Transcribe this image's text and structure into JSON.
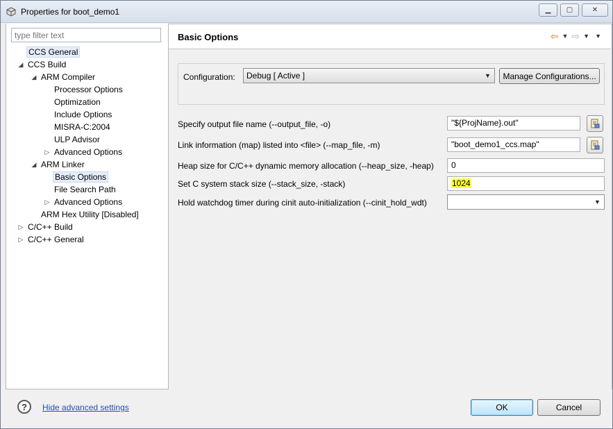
{
  "window": {
    "title": "Properties for boot_demo1",
    "icon": "properties-window-icon",
    "controls": [
      "minimize",
      "maximize",
      "close"
    ]
  },
  "filter": {
    "placeholder": "type filter text",
    "value": ""
  },
  "tree": {
    "items": [
      {
        "label": "CCS General",
        "twisty": "",
        "selected_outline": true
      },
      {
        "label": "CCS Build",
        "twisty": "expanded"
      },
      {
        "label": "ARM Compiler",
        "twisty": "expanded"
      },
      {
        "label": "Processor Options",
        "twisty": ""
      },
      {
        "label": "Optimization",
        "twisty": ""
      },
      {
        "label": "Include Options",
        "twisty": ""
      },
      {
        "label": "MISRA-C:2004",
        "twisty": ""
      },
      {
        "label": "ULP Advisor",
        "twisty": ""
      },
      {
        "label": "Advanced Options",
        "twisty": "collapsed"
      },
      {
        "label": "ARM Linker",
        "twisty": "expanded"
      },
      {
        "label": "Basic Options",
        "twisty": "",
        "selected": true
      },
      {
        "label": "File Search Path",
        "twisty": ""
      },
      {
        "label": "Advanced Options",
        "twisty": "collapsed"
      },
      {
        "label": "ARM Hex Utility  [Disabled]",
        "twisty": ""
      },
      {
        "label": "C/C++ Build",
        "twisty": "collapsed"
      },
      {
        "label": "C/C++ General",
        "twisty": "collapsed"
      }
    ]
  },
  "page": {
    "title": "Basic Options",
    "nav": {
      "back_icon": "back-arrow-icon",
      "forward_icon": "forward-arrow-icon",
      "menu_icon": "view-menu-icon"
    }
  },
  "configuration": {
    "label": "Configuration:",
    "value": "Debug  [ Active ]",
    "manage_label": "Manage Configurations..."
  },
  "options": [
    {
      "label": "Specify output file name (--output_file, -o)",
      "value": "\"${ProjName}.out\"",
      "has_browse": true
    },
    {
      "label": "Link information (map) listed into <file> (--map_file, -m)",
      "value": "\"boot_demo1_ccs.map\"",
      "has_browse": true
    },
    {
      "label": "Heap size for C/C++ dynamic memory allocation (--heap_size, -heap)",
      "value": "0"
    },
    {
      "label": "Set C system stack size (--stack_size, -stack)",
      "value": "1024",
      "highlight": "#ffff3c"
    },
    {
      "label": "Hold watchdog timer during cinit auto-initialization (--cinit_hold_wdt)",
      "value": "",
      "type": "select"
    }
  ],
  "footer": {
    "help_icon": "help-icon",
    "hide_link": "Hide advanced settings",
    "ok_label": "OK",
    "cancel_label": "Cancel"
  },
  "colors": {
    "highlight": "#ffff3c",
    "link": "#1f4fb8",
    "back_arrow": "#e6a618",
    "selection": "#e5eefb"
  }
}
